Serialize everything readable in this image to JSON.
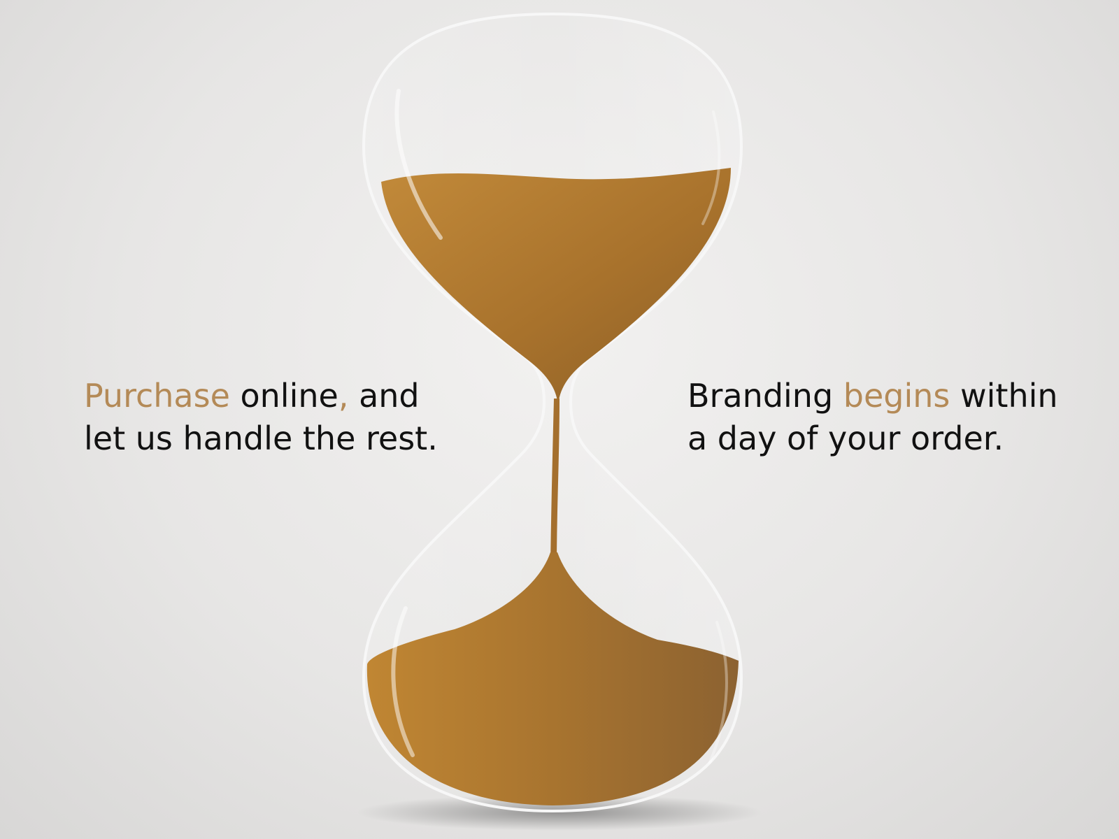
{
  "colors": {
    "accent": "#b48a57",
    "text": "#111111",
    "sand": "#b07a2e",
    "background": "#e9e8e7"
  },
  "left_caption": {
    "line1_accent": "Purchase",
    "line1_rest_a": " online",
    "line1_comma": ",",
    "line1_rest_b": " and",
    "line2": "let us handle the rest."
  },
  "right_caption": {
    "line1_a": "Branding ",
    "line1_accent": "begins",
    "line1_b": " within",
    "line2": "a day of your order."
  },
  "illustration": {
    "icon": "hourglass-icon"
  }
}
